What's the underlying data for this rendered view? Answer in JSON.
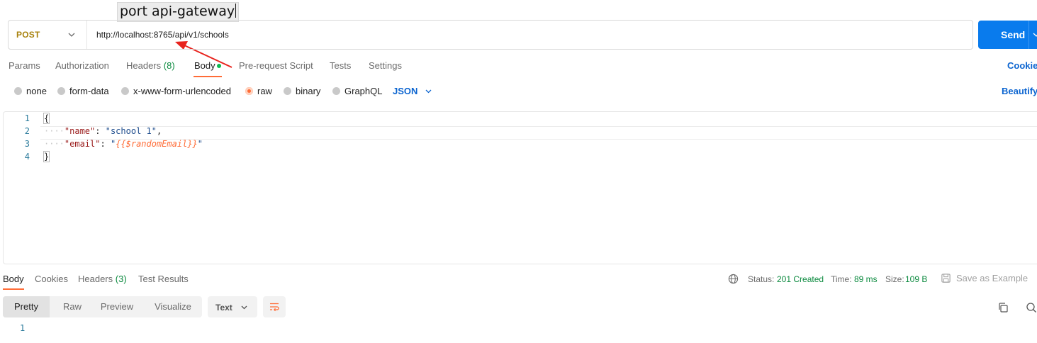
{
  "annotation": {
    "text": "port api-gateway"
  },
  "request": {
    "method": "POST",
    "url": "http://localhost:8765/api/v1/schools",
    "send_label": "Send"
  },
  "request_tabs": {
    "params": "Params",
    "authorization": "Authorization",
    "headers": "Headers",
    "headers_count": "(8)",
    "body": "Body",
    "pre_request_script": "Pre-request Script",
    "tests": "Tests",
    "settings": "Settings",
    "cookies": "Cookies"
  },
  "body_modes": {
    "none": "none",
    "form_data": "form-data",
    "urlencoded": "x-www-form-urlencoded",
    "raw": "raw",
    "binary": "binary",
    "graphql": "GraphQL",
    "selected": "raw",
    "language": "JSON",
    "beautify": "Beautify"
  },
  "editor": {
    "line_numbers": [
      "1",
      "2",
      "3",
      "4"
    ],
    "open_brace": "{",
    "close_brace": "}",
    "indent": "····",
    "name_key": "\"name\"",
    "name_value": "\"school 1\"",
    "email_key": "\"email\"",
    "email_quote_open": "\"",
    "email_value": "{{$randomEmail}}",
    "email_quote_close": "\"",
    "colon": ": ",
    "comma": ","
  },
  "response_tabs": {
    "body": "Body",
    "cookies": "Cookies",
    "headers": "Headers",
    "headers_count": "(3)",
    "test_results": "Test Results"
  },
  "response_meta": {
    "status_label": "Status:",
    "status_value": "201 Created",
    "time_label": "Time:",
    "time_value": "89 ms",
    "size_label": "Size:",
    "size_value": "109 B",
    "save_as_example": "Save as Example"
  },
  "response_view": {
    "pretty": "Pretty",
    "raw": "Raw",
    "preview": "Preview",
    "visualize": "Visualize",
    "format": "Text",
    "line_number": "1"
  },
  "colors": {
    "accent": "#ff6c37",
    "send_button": "#097bed",
    "method_post": "#a8820e",
    "success": "#0c8a3f",
    "link": "#0b64d0",
    "annotation_arrow": "#e8231d"
  },
  "icons": [
    "chevron-down-icon",
    "globe-icon",
    "save-icon",
    "wrap-lines-icon",
    "copy-icon",
    "search-icon"
  ]
}
